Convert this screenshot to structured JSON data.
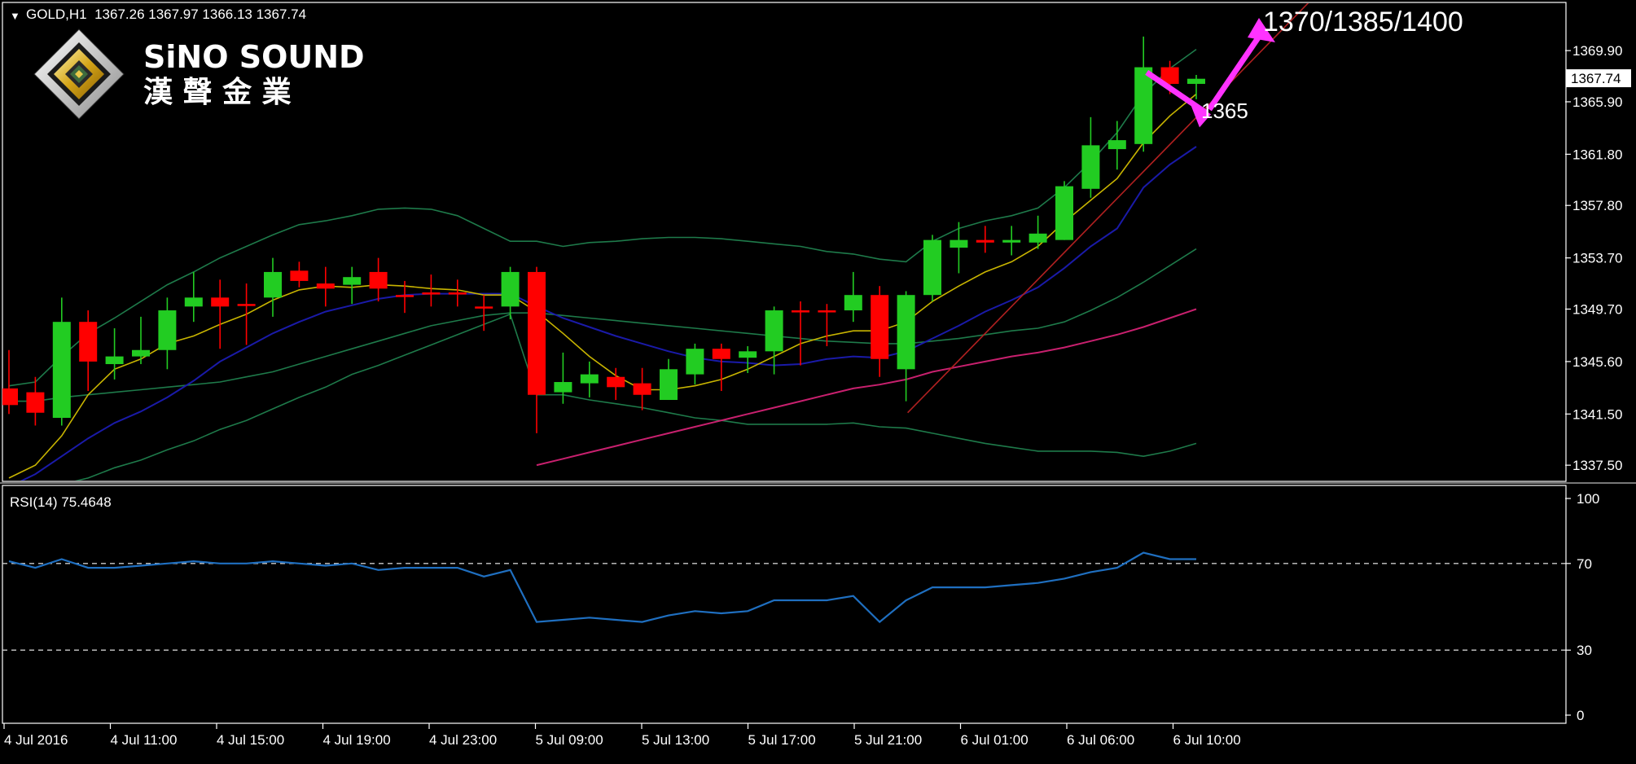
{
  "window": {
    "symbol_header": "GOLD,H1  1367.26 1367.97 1366.13 1367.74",
    "dropdown_glyph": "▼"
  },
  "logo": {
    "brand_en": "SiNO SOUND",
    "brand_cn": "漢 聲 金 業"
  },
  "price_axis": {
    "labels": [
      "1369.90",
      "1365.90",
      "1361.80",
      "1357.80",
      "1353.70",
      "1349.70",
      "1345.60",
      "1341.50",
      "1337.50"
    ],
    "current_price_tag": "1367.74"
  },
  "rsi_panel": {
    "title": "RSI(14) 75.4648",
    "labels": [
      "100",
      "70",
      "30",
      "0"
    ]
  },
  "time_axis": {
    "labels": [
      "4 Jul 2016",
      "4 Jul 11:00",
      "4 Jul 15:00",
      "4 Jul 19:00",
      "4 Jul 23:00",
      "5 Jul 09:00",
      "5 Jul 13:00",
      "5 Jul 17:00",
      "5 Jul 21:00",
      "6 Jul 01:00",
      "6 Jul 06:00",
      "6 Jul 10:00"
    ]
  },
  "annotations": {
    "target_text": "1370/1385/1400",
    "support_text": "1365"
  },
  "colors": {
    "background": "#000000",
    "bull": "#22cc22",
    "bear": "#ff0000",
    "ma_fast": "#c8b400",
    "ma_mid": "#1a1aa8",
    "bollinger": "#1e7a4a",
    "ma_slow": "#c8206e",
    "trendline": "#b02020",
    "arrow": "#ff33ff",
    "rsi_line": "#1f6fc0",
    "level_line": "#cccccc"
  },
  "chart_data": [
    {
      "type": "candlestick",
      "title": "GOLD,H1",
      "ylim": [
        1336.3,
        1373.6
      ],
      "candles": [
        {
          "o": 1343.5,
          "h": 1346.5,
          "l": 1341.5,
          "c": 1342.2
        },
        {
          "o": 1343.2,
          "h": 1344.4,
          "l": 1340.6,
          "c": 1341.6
        },
        {
          "o": 1341.2,
          "h": 1350.6,
          "l": 1340.6,
          "c": 1348.7
        },
        {
          "o": 1348.7,
          "h": 1349.6,
          "l": 1343.3,
          "c": 1345.6
        },
        {
          "o": 1345.4,
          "h": 1348.2,
          "l": 1344.2,
          "c": 1346.0
        },
        {
          "o": 1346.0,
          "h": 1349.1,
          "l": 1345.4,
          "c": 1346.5
        },
        {
          "o": 1346.5,
          "h": 1350.6,
          "l": 1345.0,
          "c": 1349.6
        },
        {
          "o": 1349.9,
          "h": 1352.6,
          "l": 1348.7,
          "c": 1350.6
        },
        {
          "o": 1350.6,
          "h": 1352.0,
          "l": 1346.6,
          "c": 1349.9
        },
        {
          "o": 1350.1,
          "h": 1351.7,
          "l": 1346.9,
          "c": 1350.1
        },
        {
          "o": 1350.6,
          "h": 1353.7,
          "l": 1349.1,
          "c": 1352.6
        },
        {
          "o": 1352.7,
          "h": 1353.4,
          "l": 1351.4,
          "c": 1351.9
        },
        {
          "o": 1351.7,
          "h": 1353.0,
          "l": 1349.9,
          "c": 1351.3
        },
        {
          "o": 1351.6,
          "h": 1353.0,
          "l": 1350.1,
          "c": 1352.2
        },
        {
          "o": 1352.6,
          "h": 1353.7,
          "l": 1350.3,
          "c": 1351.3
        },
        {
          "o": 1350.8,
          "h": 1351.9,
          "l": 1349.4,
          "c": 1350.8
        },
        {
          "o": 1351.0,
          "h": 1352.4,
          "l": 1349.9,
          "c": 1351.0
        },
        {
          "o": 1351.0,
          "h": 1352.0,
          "l": 1349.9,
          "c": 1351.0
        },
        {
          "o": 1349.9,
          "h": 1350.8,
          "l": 1348.0,
          "c": 1349.9
        },
        {
          "o": 1349.9,
          "h": 1353.0,
          "l": 1348.9,
          "c": 1352.6
        },
        {
          "o": 1352.6,
          "h": 1353.0,
          "l": 1340.0,
          "c": 1343.0
        },
        {
          "o": 1343.2,
          "h": 1346.3,
          "l": 1342.3,
          "c": 1344.0
        },
        {
          "o": 1343.9,
          "h": 1345.6,
          "l": 1342.8,
          "c": 1344.6
        },
        {
          "o": 1344.4,
          "h": 1345.1,
          "l": 1342.6,
          "c": 1343.6
        },
        {
          "o": 1343.9,
          "h": 1345.1,
          "l": 1341.8,
          "c": 1343.0
        },
        {
          "o": 1342.6,
          "h": 1345.8,
          "l": 1342.6,
          "c": 1345.0
        },
        {
          "o": 1344.6,
          "h": 1347.0,
          "l": 1343.8,
          "c": 1346.6
        },
        {
          "o": 1346.6,
          "h": 1347.0,
          "l": 1343.3,
          "c": 1345.8
        },
        {
          "o": 1345.9,
          "h": 1346.8,
          "l": 1344.7,
          "c": 1346.4
        },
        {
          "o": 1346.4,
          "h": 1349.9,
          "l": 1344.6,
          "c": 1349.6
        },
        {
          "o": 1349.6,
          "h": 1350.3,
          "l": 1345.3,
          "c": 1349.6
        },
        {
          "o": 1349.6,
          "h": 1350.1,
          "l": 1346.8,
          "c": 1349.6
        },
        {
          "o": 1349.6,
          "h": 1352.6,
          "l": 1348.7,
          "c": 1350.8
        },
        {
          "o": 1350.8,
          "h": 1351.5,
          "l": 1344.4,
          "c": 1345.8
        },
        {
          "o": 1345.0,
          "h": 1351.1,
          "l": 1342.5,
          "c": 1350.8
        },
        {
          "o": 1350.8,
          "h": 1355.5,
          "l": 1350.3,
          "c": 1355.1
        },
        {
          "o": 1354.5,
          "h": 1356.5,
          "l": 1352.5,
          "c": 1355.1
        },
        {
          "o": 1355.1,
          "h": 1356.2,
          "l": 1354.1,
          "c": 1354.9
        },
        {
          "o": 1354.9,
          "h": 1356.2,
          "l": 1353.9,
          "c": 1355.1
        },
        {
          "o": 1354.9,
          "h": 1357.0,
          "l": 1354.4,
          "c": 1355.6
        },
        {
          "o": 1355.1,
          "h": 1359.7,
          "l": 1355.1,
          "c": 1359.3
        },
        {
          "o": 1359.1,
          "h": 1364.7,
          "l": 1358.4,
          "c": 1362.5
        },
        {
          "o": 1362.2,
          "h": 1364.4,
          "l": 1360.6,
          "c": 1362.9
        },
        {
          "o": 1362.6,
          "h": 1371.0,
          "l": 1362.0,
          "c": 1368.6
        },
        {
          "o": 1368.6,
          "h": 1369.1,
          "l": 1366.5,
          "c": 1367.3
        },
        {
          "o": 1367.3,
          "h": 1368.0,
          "l": 1366.1,
          "c": 1367.7
        }
      ],
      "overlays": {
        "ma_fast": [
          1336.5,
          1337.5,
          1339.8,
          1343.0,
          1345.0,
          1345.8,
          1347.0,
          1347.6,
          1348.5,
          1349.3,
          1350.4,
          1351.2,
          1351.5,
          1351.4,
          1351.6,
          1351.5,
          1351.3,
          1351.2,
          1350.8,
          1350.8,
          1349.5,
          1347.8,
          1346.0,
          1344.5,
          1343.4,
          1343.4,
          1343.7,
          1344.2,
          1345.0,
          1346.0,
          1347.0,
          1347.6,
          1348.0,
          1348.0,
          1348.7,
          1350.3,
          1351.5,
          1352.6,
          1353.4,
          1354.6,
          1356.5,
          1358.2,
          1359.9,
          1362.7,
          1364.8,
          1366.5
        ],
        "ma_mid": [
          1335.8,
          1336.8,
          1338.2,
          1339.6,
          1340.8,
          1341.7,
          1342.8,
          1344.1,
          1345.6,
          1346.7,
          1347.8,
          1348.7,
          1349.5,
          1350.0,
          1350.5,
          1350.8,
          1350.9,
          1350.9,
          1350.9,
          1350.9,
          1349.9,
          1349.0,
          1348.3,
          1347.6,
          1347.0,
          1346.4,
          1345.9,
          1345.6,
          1345.5,
          1345.3,
          1345.4,
          1345.8,
          1346.0,
          1345.9,
          1346.4,
          1347.4,
          1348.4,
          1349.5,
          1350.4,
          1351.4,
          1352.9,
          1354.6,
          1356.0,
          1359.2,
          1361.0,
          1362.4
        ],
        "bb_upper": [
          1343.7,
          1344.0,
          1346.0,
          1347.8,
          1349.0,
          1350.3,
          1351.6,
          1352.6,
          1353.7,
          1354.6,
          1355.5,
          1356.3,
          1356.6,
          1357.0,
          1357.5,
          1357.6,
          1357.5,
          1357.0,
          1356.0,
          1355.0,
          1355.0,
          1354.6,
          1354.9,
          1355.0,
          1355.2,
          1355.3,
          1355.3,
          1355.2,
          1355.0,
          1354.8,
          1354.6,
          1354.2,
          1354.0,
          1353.6,
          1353.4,
          1355.0,
          1356.0,
          1356.6,
          1357.0,
          1357.6,
          1359.2,
          1361.2,
          1363.5,
          1366.5,
          1368.5,
          1370.0
        ],
        "bb_middle": [
          1342.5,
          1342.5,
          1342.8,
          1343.0,
          1343.2,
          1343.4,
          1343.6,
          1343.8,
          1344.0,
          1344.4,
          1344.8,
          1345.4,
          1346.0,
          1346.6,
          1347.2,
          1347.8,
          1348.4,
          1348.8,
          1349.2,
          1349.4,
          1349.4,
          1349.2,
          1349.0,
          1348.8,
          1348.6,
          1348.4,
          1348.2,
          1348.0,
          1347.8,
          1347.6,
          1347.4,
          1347.2,
          1347.1,
          1347.0,
          1347.0,
          1347.2,
          1347.4,
          1347.7,
          1348.0,
          1348.2,
          1348.7,
          1349.6,
          1350.6,
          1351.8,
          1353.1,
          1354.4
        ],
        "bb_lower": [
          1334.0,
          1334.0,
          1336.0,
          1336.5,
          1337.3,
          1337.9,
          1338.7,
          1339.4,
          1340.3,
          1341.0,
          1341.9,
          1342.8,
          1343.6,
          1344.6,
          1345.3,
          1346.1,
          1346.9,
          1347.7,
          1348.5,
          1349.3,
          1343.0,
          1343.0,
          1342.6,
          1342.3,
          1342.0,
          1341.6,
          1341.2,
          1341.0,
          1340.7,
          1340.7,
          1340.7,
          1340.7,
          1340.8,
          1340.5,
          1340.4,
          1340.0,
          1339.6,
          1339.2,
          1338.9,
          1338.6,
          1338.6,
          1338.6,
          1338.5,
          1338.2,
          1338.6,
          1339.2
        ],
        "ma_slow": [
          null,
          null,
          null,
          null,
          null,
          null,
          null,
          null,
          null,
          null,
          null,
          null,
          null,
          null,
          null,
          null,
          null,
          null,
          null,
          null,
          1337.5,
          1338.0,
          1338.5,
          1339.0,
          1339.5,
          1340.0,
          1340.5,
          1341.0,
          1341.5,
          1342.0,
          1342.5,
          1343.0,
          1343.5,
          1343.8,
          1344.2,
          1344.8,
          1345.2,
          1345.6,
          1346.0,
          1346.3,
          1346.7,
          1347.2,
          1347.7,
          1348.3,
          1349.0,
          1349.7
        ]
      }
    },
    {
      "type": "line",
      "title": "RSI(14) 75.4648",
      "ylim": [
        0,
        100
      ],
      "levels": [
        70,
        30
      ],
      "values": [
        71,
        68,
        72,
        68,
        68,
        69,
        70,
        71,
        70,
        70,
        71,
        70,
        69,
        70,
        67,
        68,
        68,
        68,
        64,
        67,
        43,
        44,
        45,
        44,
        43,
        46,
        48,
        47,
        48,
        53,
        53,
        53,
        55,
        43,
        53,
        59,
        59,
        59,
        60,
        61,
        63,
        66,
        68,
        75,
        72,
        72
      ]
    }
  ]
}
